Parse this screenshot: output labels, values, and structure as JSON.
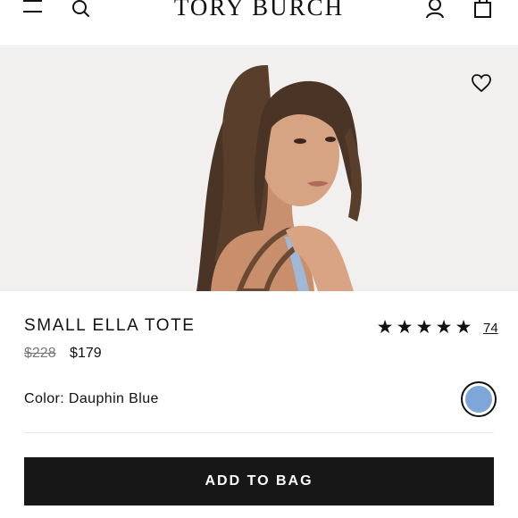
{
  "header": {
    "brand": "TORY BURCH",
    "icons": [
      "hamburger-menu-icon",
      "search-icon",
      "account-icon",
      "shopping-bag-icon"
    ]
  },
  "hero": {
    "wishlist_icon": "heart-icon"
  },
  "product": {
    "name": "SMALL ELLA TOTE",
    "original_price": "$228",
    "sale_price": "$179",
    "rating_stars": 5,
    "review_count": "74",
    "color_label": "Color: Dauphin Blue",
    "swatch_color": "#7fa6d8"
  },
  "cta": {
    "add_to_bag_label": "ADD TO BAG"
  },
  "colors": {
    "text": "#111111",
    "button_bg": "#171717",
    "button_text": "#ffffff",
    "hero_bg": "#f1f0ee"
  }
}
